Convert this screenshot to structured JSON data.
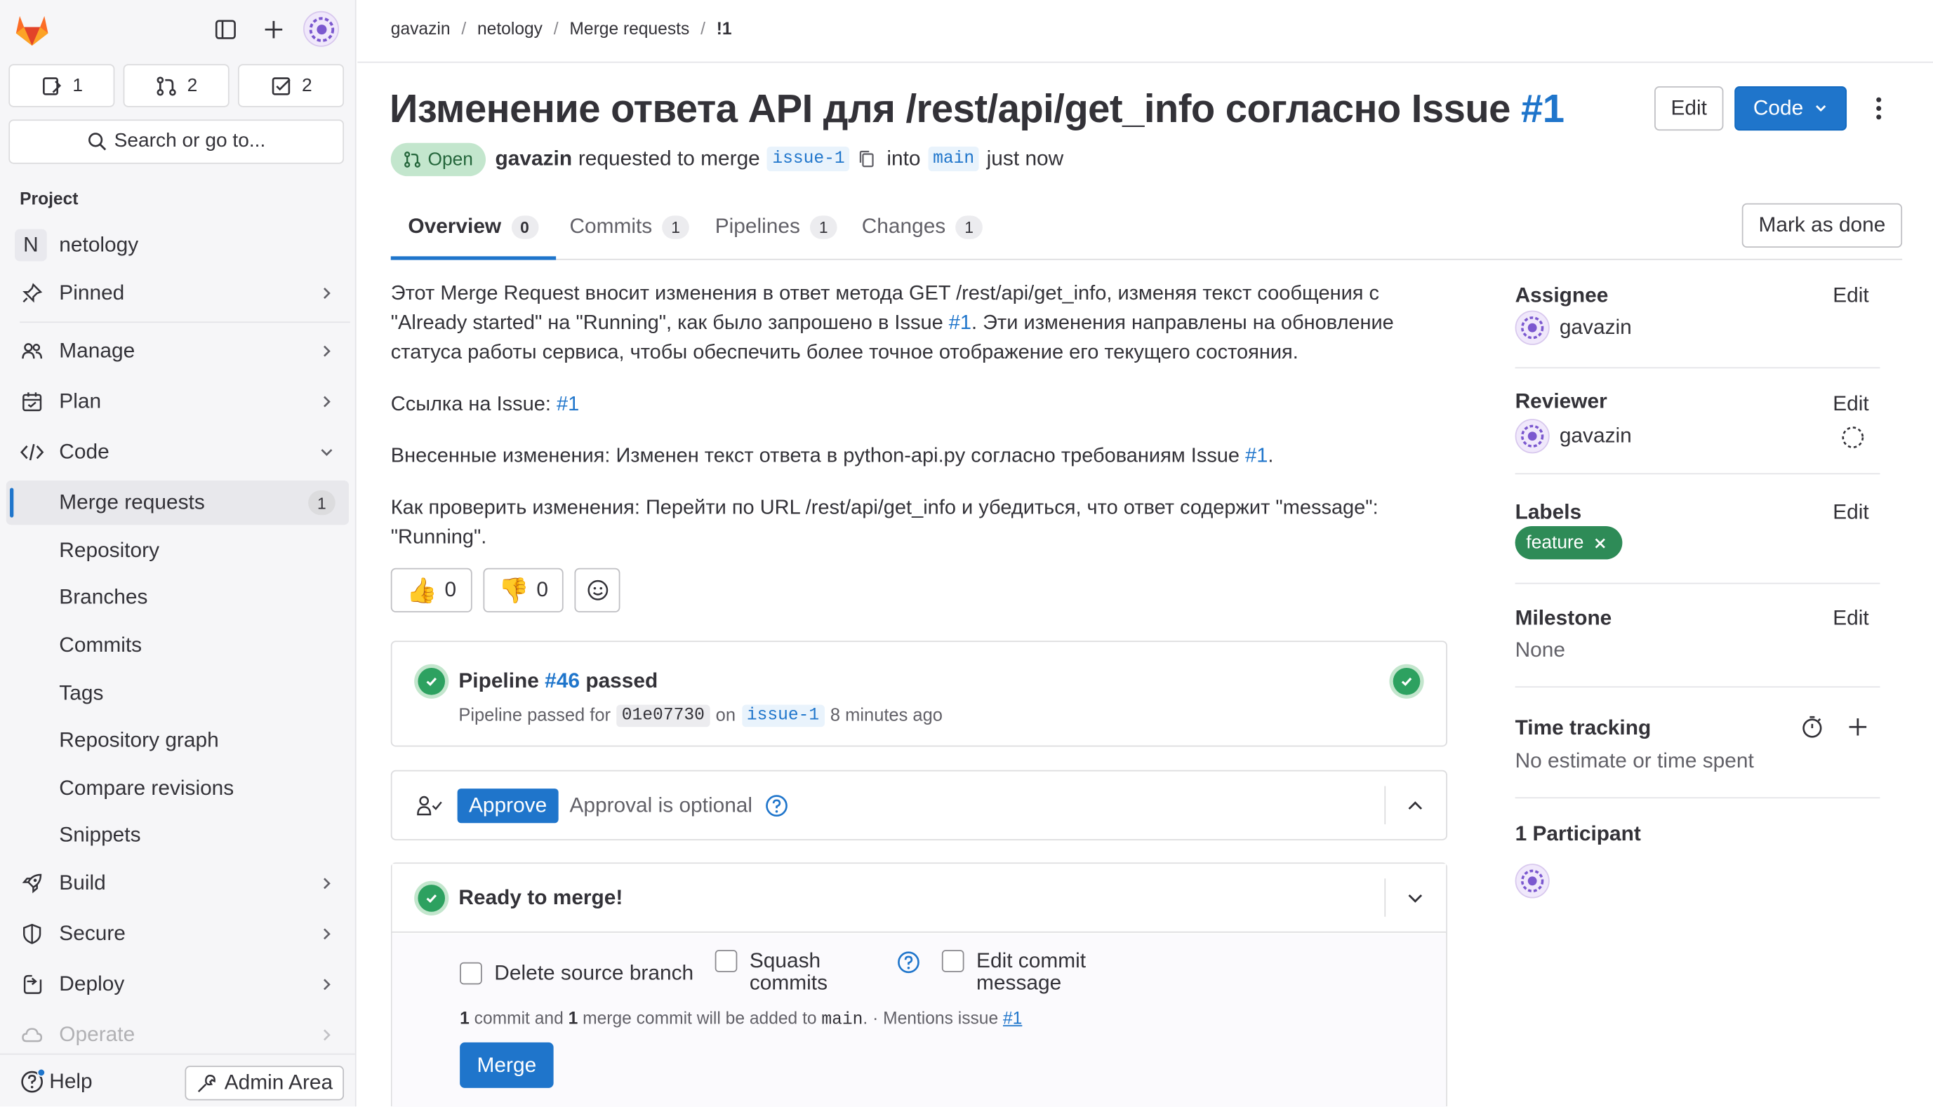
{
  "sidebar": {
    "counts": [
      {
        "icon": "issues-icon",
        "value": "1"
      },
      {
        "icon": "merge-request-icon",
        "value": "2"
      },
      {
        "icon": "todo-icon",
        "value": "2"
      }
    ],
    "search_label": "Search or go to...",
    "section_title": "Project",
    "project": {
      "initial": "N",
      "name": "netology"
    },
    "items": {
      "pinned": "Pinned",
      "manage": "Manage",
      "plan": "Plan",
      "code": "Code",
      "merge_requests": "Merge requests",
      "merge_requests_count": "1",
      "repository": "Repository",
      "branches": "Branches",
      "commits": "Commits",
      "tags": "Tags",
      "repository_graph": "Repository graph",
      "compare_revisions": "Compare revisions",
      "snippets": "Snippets",
      "build": "Build",
      "secure": "Secure",
      "deploy": "Deploy",
      "operate": "Operate"
    },
    "help": "Help",
    "admin_area": "Admin Area"
  },
  "breadcrumb": [
    "gavazin",
    "netology",
    "Merge requests",
    "!1"
  ],
  "mr": {
    "title": "Изменение ответа API для /rest/api/get_info согласно Issue ",
    "title_ref": "#1",
    "edit_label": "Edit",
    "code_label": "Code",
    "status": "Open",
    "author": "gavazin",
    "requested_text": "requested to merge",
    "source_branch": "issue-1",
    "into_text": "into",
    "target_branch": "main",
    "time": "just now"
  },
  "tabs": [
    {
      "label": "Overview",
      "count": "0"
    },
    {
      "label": "Commits",
      "count": "1"
    },
    {
      "label": "Pipelines",
      "count": "1"
    },
    {
      "label": "Changes",
      "count": "1"
    }
  ],
  "mark_as_done": "Mark as done",
  "description": {
    "p1_a": "Этот Merge Request вносит изменения в ответ метода GET /rest/api/get_info, изменяя текст сообщения с \"Already started\" на \"Running\", как было запрошено в Issue ",
    "p1_link": "#1",
    "p1_b": ". Эти изменения направлены на обновление статуса работы сервиса, чтобы обеспечить более точное отображение его текущего состояния.",
    "p2_a": "Ссылка на Issue: ",
    "p2_link": "#1",
    "p3_a": "Внесенные изменения: Изменен текст ответа в python-api.py согласно требованиям Issue ",
    "p3_link": "#1",
    "p3_b": ".",
    "p4": "Как проверить изменения: Перейти по URL /rest/api/get_info и убедиться, что ответ содержит \"message\": \"Running\"."
  },
  "reactions": {
    "thumbs_up": "0",
    "thumbs_down": "0"
  },
  "pipeline": {
    "label": "Pipeline",
    "id": "#46",
    "status": "passed",
    "passed_for": "Pipeline passed for",
    "commit": "01e07730",
    "on": "on",
    "branch": "issue-1",
    "ago": "8 minutes ago"
  },
  "approval": {
    "approve_label": "Approve",
    "optional_text": "Approval is optional"
  },
  "merge": {
    "ready": "Ready to merge!",
    "delete_source": "Delete source branch",
    "squash_line1": "Squash",
    "squash_line2": "commits",
    "edit_msg_line1": "Edit commit",
    "edit_msg_line2": "message",
    "info_n1": "1",
    "info_a": " commit and ",
    "info_n2": "1",
    "info_b": " merge commit will be added to ",
    "info_branch": "main",
    "info_c": ". · Mentions issue ",
    "info_link": "#1",
    "merge_button": "Merge"
  },
  "right_sidebar": {
    "assignee_title": "Assignee",
    "assignee": "gavazin",
    "reviewer_title": "Reviewer",
    "reviewer": "gavazin",
    "labels_title": "Labels",
    "label": "feature",
    "milestone_title": "Milestone",
    "milestone": "None",
    "time_title": "Time tracking",
    "time_value": "No estimate or time spent",
    "participants_title": "1 Participant",
    "edit": "Edit"
  },
  "colors": {
    "accent": "#1f75cb",
    "success": "#2da160",
    "label": "#2e8b57",
    "open_badge_bg": "#c3e6cd"
  }
}
